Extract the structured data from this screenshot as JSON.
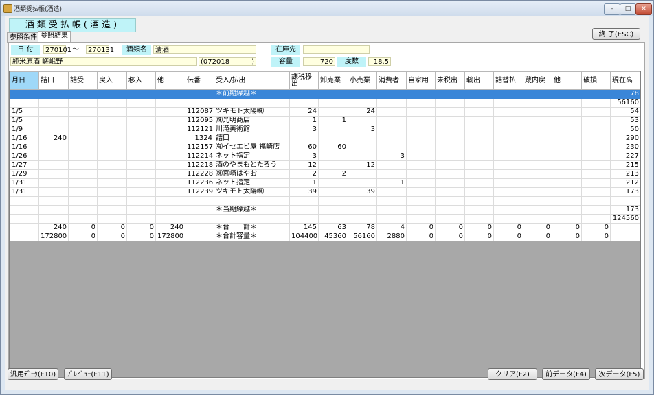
{
  "window": {
    "title": "酒類受払帳(酒造)",
    "controls": [
      "–",
      "□",
      "✕"
    ]
  },
  "app_title": "酒類受払帳(酒造)",
  "tabs": [
    {
      "label": "参照条件"
    },
    {
      "label": "参照結果"
    }
  ],
  "buttons": {
    "exit": "終 了(ESC)",
    "generic_data": "汎用ﾃﾞｰﾀ(F10)",
    "preview": "ﾌﾟﾚﾋﾞｭｰ(F11)",
    "clear": "クリア(F2)",
    "prev_data": "前データ(F4)",
    "next_data": "次データ(F5)"
  },
  "filters": {
    "date_label": "日 付",
    "date_from": "270101",
    "date_sep": "～",
    "date_to": "270131",
    "sake_label": "酒類名",
    "sake_value": "清酒",
    "warehouse_label": "在庫先",
    "warehouse_value": "",
    "product": "純米原酒 嵯峨野",
    "code": "(072018",
    "code_close": ")",
    "volume_label": "容量",
    "volume_value": "720",
    "degree_label": "度数",
    "degree_value": "18.5"
  },
  "table": {
    "columns": [
      "月日",
      "詰口",
      "詰受",
      "戻入",
      "移入",
      "他",
      "伝番",
      "受入/払出",
      "課税移出",
      "卸売業",
      "小売業",
      "消費者",
      "自家用",
      "未税出",
      "輸出",
      "詰替払",
      "蔵内戻",
      "他",
      "破損",
      "現在高"
    ],
    "rows": [
      [
        "",
        "",
        "",
        "",
        "",
        "",
        "",
        "＊前期繰越＊",
        "",
        "",
        "",
        "",
        "",
        "",
        "",
        "",
        "",
        "",
        "",
        "78"
      ],
      [
        "",
        "",
        "",
        "",
        "",
        "",
        "",
        "",
        "",
        "",
        "",
        "",
        "",
        "",
        "",
        "",
        "",
        "",
        "",
        "56160"
      ],
      [
        "1/5",
        "",
        "",
        "",
        "",
        "",
        "112087",
        "ツキモト太陽㈱",
        "24",
        "",
        "24",
        "",
        "",
        "",
        "",
        "",
        "",
        "",
        "",
        "54"
      ],
      [
        "1/5",
        "",
        "",
        "",
        "",
        "",
        "112095",
        "㈱光明商店",
        "1",
        "1",
        "",
        "",
        "",
        "",
        "",
        "",
        "",
        "",
        "",
        "53"
      ],
      [
        "1/9",
        "",
        "",
        "",
        "",
        "",
        "112121",
        "川滝美術館",
        "3",
        "",
        "3",
        "",
        "",
        "",
        "",
        "",
        "",
        "",
        "",
        "50"
      ],
      [
        "1/16",
        "240",
        "",
        "",
        "",
        "",
        "1324",
        "詰口",
        "",
        "",
        "",
        "",
        "",
        "",
        "",
        "",
        "",
        "",
        "",
        "290"
      ],
      [
        "1/16",
        "",
        "",
        "",
        "",
        "",
        "112157",
        "㈲イセエビ屋 福崎店",
        "60",
        "60",
        "",
        "",
        "",
        "",
        "",
        "",
        "",
        "",
        "",
        "230"
      ],
      [
        "1/26",
        "",
        "",
        "",
        "",
        "",
        "112214",
        "ネット指定",
        "3",
        "",
        "",
        "3",
        "",
        "",
        "",
        "",
        "",
        "",
        "",
        "227"
      ],
      [
        "1/27",
        "",
        "",
        "",
        "",
        "",
        "112218",
        "酒のやまもとたろう",
        "12",
        "",
        "12",
        "",
        "",
        "",
        "",
        "",
        "",
        "",
        "",
        "215"
      ],
      [
        "1/29",
        "",
        "",
        "",
        "",
        "",
        "112228",
        "㈱宮﨑はやお",
        "2",
        "2",
        "",
        "",
        "",
        "",
        "",
        "",
        "",
        "",
        "",
        "213"
      ],
      [
        "1/31",
        "",
        "",
        "",
        "",
        "",
        "112236",
        "ネット指定",
        "1",
        "",
        "",
        "1",
        "",
        "",
        "",
        "",
        "",
        "",
        "",
        "212"
      ],
      [
        "1/31",
        "",
        "",
        "",
        "",
        "",
        "112239",
        "ツキモト太陽㈱",
        "39",
        "",
        "39",
        "",
        "",
        "",
        "",
        "",
        "",
        "",
        "",
        "173"
      ],
      [
        "",
        "",
        "",
        "",
        "",
        "",
        "",
        "",
        "",
        "",
        "",
        "",
        "",
        "",
        "",
        "",
        "",
        "",
        "",
        ""
      ],
      [
        "",
        "",
        "",
        "",
        "",
        "",
        "",
        "＊当期繰越＊",
        "",
        "",
        "",
        "",
        "",
        "",
        "",
        "",
        "",
        "",
        "",
        "173"
      ],
      [
        "",
        "",
        "",
        "",
        "",
        "",
        "",
        "",
        "",
        "",
        "",
        "",
        "",
        "",
        "",
        "",
        "",
        "",
        "",
        "124560"
      ],
      [
        "",
        "240",
        "0",
        "0",
        "0",
        "240",
        "",
        "＊合　　計＊",
        "145",
        "63",
        "78",
        "4",
        "0",
        "0",
        "0",
        "0",
        "0",
        "0",
        "0",
        ""
      ],
      [
        "",
        "172800",
        "0",
        "0",
        "0",
        "172800",
        "",
        "＊合計容量＊",
        "104400",
        "45360",
        "56160",
        "2880",
        "0",
        "0",
        "0",
        "0",
        "0",
        "0",
        "0",
        ""
      ]
    ]
  }
}
